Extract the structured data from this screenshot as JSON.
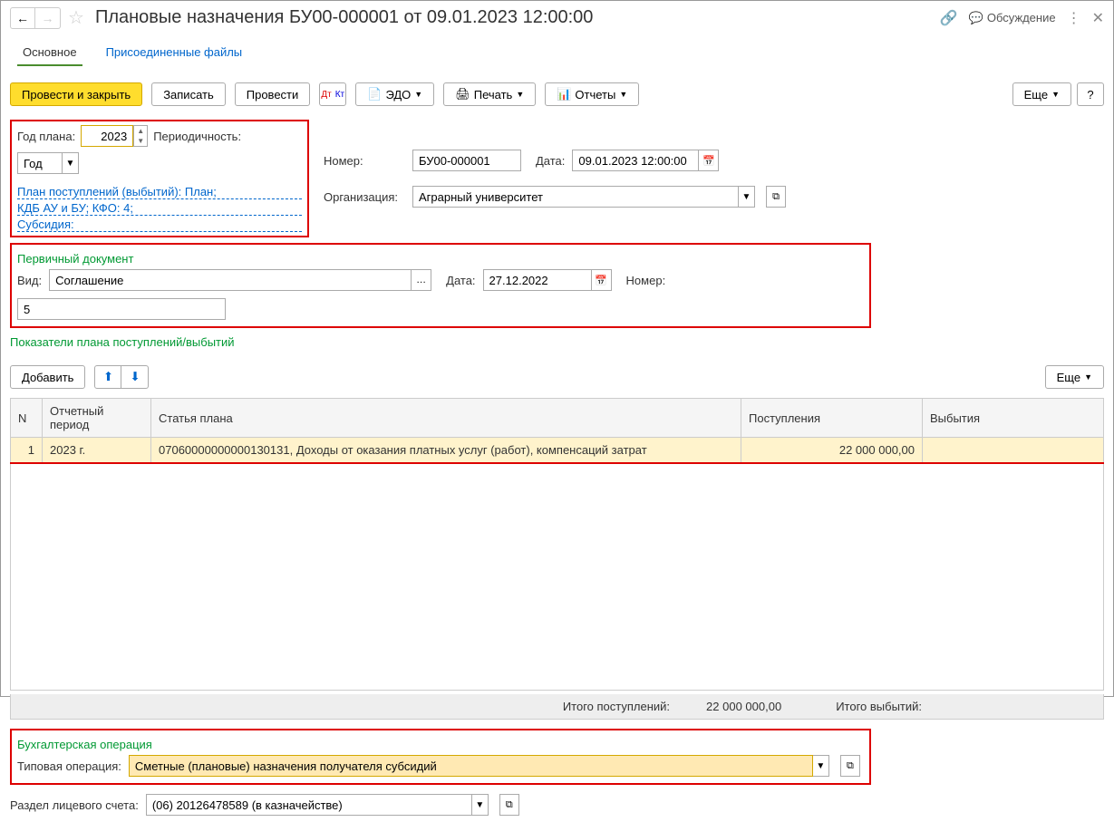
{
  "header": {
    "title": "Плановые назначения БУ00-000001 от 09.01.2023 12:00:00",
    "discuss": "Обсуждение"
  },
  "tabs": {
    "main": "Основное",
    "files": "Присоединенные файлы"
  },
  "toolbar": {
    "submit_close": "Провести и закрыть",
    "save": "Записать",
    "submit": "Провести",
    "edo": "ЭДО",
    "print": "Печать",
    "reports": "Отчеты",
    "more": "Еще"
  },
  "form": {
    "year_label": "Год плана:",
    "year_value": "2023",
    "period_label": "Периодичность:",
    "period_value": "Год",
    "number_label": "Номер:",
    "number_value": "БУ00-000001",
    "date_label": "Дата:",
    "date_value": "09.01.2023 12:00:00",
    "org_label": "Организация:",
    "org_value": "Аграрный университет",
    "plan_link1": "План поступлений (выбытий): План;",
    "plan_link2": "КДБ АУ и БУ; КФО: 4;",
    "plan_link3": "Субсидия:"
  },
  "primary_doc": {
    "title": "Первичный документ",
    "type_label": "Вид:",
    "type_value": "Соглашение",
    "date_label": "Дата:",
    "date_value": "27.12.2022",
    "number_label": "Номер:",
    "number_value": "5"
  },
  "indicators": {
    "title": "Показатели плана поступлений/выбытий",
    "add": "Добавить",
    "more": "Еще",
    "cols": {
      "n": "N",
      "period": "Отчетный период",
      "item": "Статья плана",
      "income": "Поступления",
      "outcome": "Выбытия"
    },
    "rows": [
      {
        "n": "1",
        "period": "2023 г.",
        "item": "07060000000000130131, Доходы от оказания платных услуг (работ), компенсаций затрат",
        "income": "22 000 000,00",
        "outcome": ""
      }
    ],
    "total_income_label": "Итого поступлений:",
    "total_income_value": "22 000 000,00",
    "total_outcome_label": "Итого выбытий:",
    "total_outcome_value": ""
  },
  "operation": {
    "title": "Бухгалтерская операция",
    "label": "Типовая операция:",
    "value": "Сметные (плановые) назначения получателя субсидий"
  },
  "account": {
    "label": "Раздел лицевого счета:",
    "value": "(06) 20126478589 (в казначействе)"
  }
}
